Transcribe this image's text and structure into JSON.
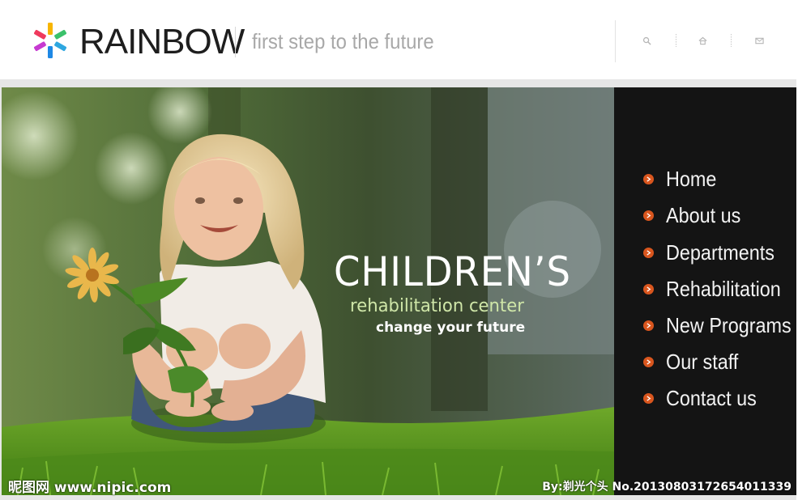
{
  "header": {
    "brand": "RAINBOW",
    "tagline": "first step to the future",
    "tools": [
      {
        "icon": "search-icon"
      },
      {
        "icon": "home-icon"
      },
      {
        "icon": "mail-icon"
      }
    ]
  },
  "hero": {
    "title": "CHILDREN’S",
    "subtitle": "rehabilitation center",
    "cta": "change your future"
  },
  "nav": {
    "items": [
      {
        "label": "Home"
      },
      {
        "label": "About us"
      },
      {
        "label": "Departments"
      },
      {
        "label": "Rehabilitation"
      },
      {
        "label": "New Programs"
      },
      {
        "label": "Our staff"
      },
      {
        "label": "Contact us"
      }
    ]
  },
  "watermark": {
    "left": "昵图网 www.nipic.com",
    "right": "By:剃光个头  No.20130803172654011339"
  },
  "colors": {
    "nav_bg": "#141414",
    "bullet": "#d9561e",
    "brand_text": "#1e1e1e",
    "tagline_text": "#a8a8a8",
    "subtitle_text": "#cfe6a8"
  }
}
